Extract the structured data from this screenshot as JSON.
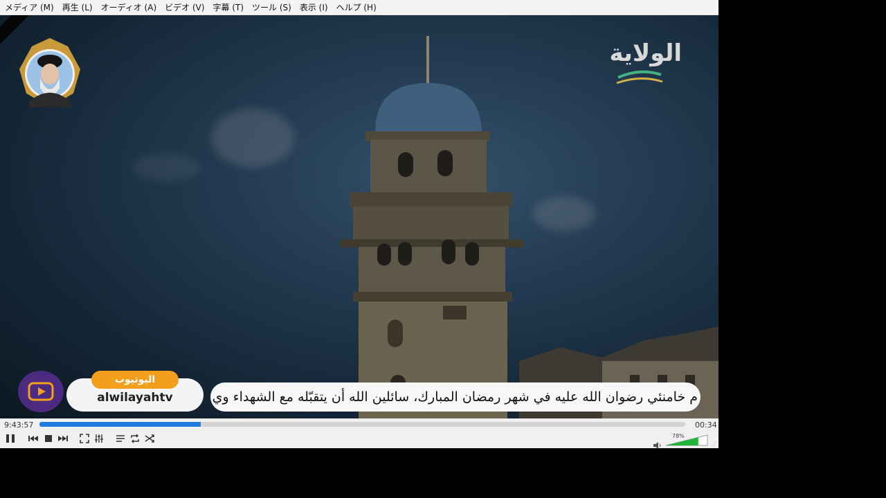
{
  "menu": [
    {
      "label": "メディア (M)",
      "name": "menu-media"
    },
    {
      "label": "再生 (L)",
      "name": "menu-playback"
    },
    {
      "label": "オーディオ (A)",
      "name": "menu-audio"
    },
    {
      "label": "ビデオ (V)",
      "name": "menu-video"
    },
    {
      "label": "字幕 (T)",
      "name": "menu-subtitle"
    },
    {
      "label": "ツール (S)",
      "name": "menu-tools"
    },
    {
      "label": "表示 (I)",
      "name": "menu-view"
    },
    {
      "label": "ヘルプ (H)",
      "name": "menu-help"
    }
  ],
  "video": {
    "youtube_tag": "اليوتيوب",
    "youtube_handle": "alwilayahtv",
    "ticker": "م خامنئي رضوان الله عليه في شهر رمضان المبارك، سائلين الله أن يتقبّله مع الشهداء وي",
    "channel_logo_text": "الولاية"
  },
  "player": {
    "elapsed": "9:43:57",
    "remaining": "00:34",
    "progress": 0.25,
    "volume_percent": "78%",
    "volume": 0.78,
    "accent": "#1e7be0",
    "volume_color": "#21b63a"
  },
  "icons": [
    "pause-icon",
    "previous-icon",
    "stop-icon",
    "next-icon",
    "fullscreen-icon",
    "extended-settings-icon",
    "playlist-icon",
    "loop-icon",
    "shuffle-icon",
    "speaker-icon"
  ]
}
